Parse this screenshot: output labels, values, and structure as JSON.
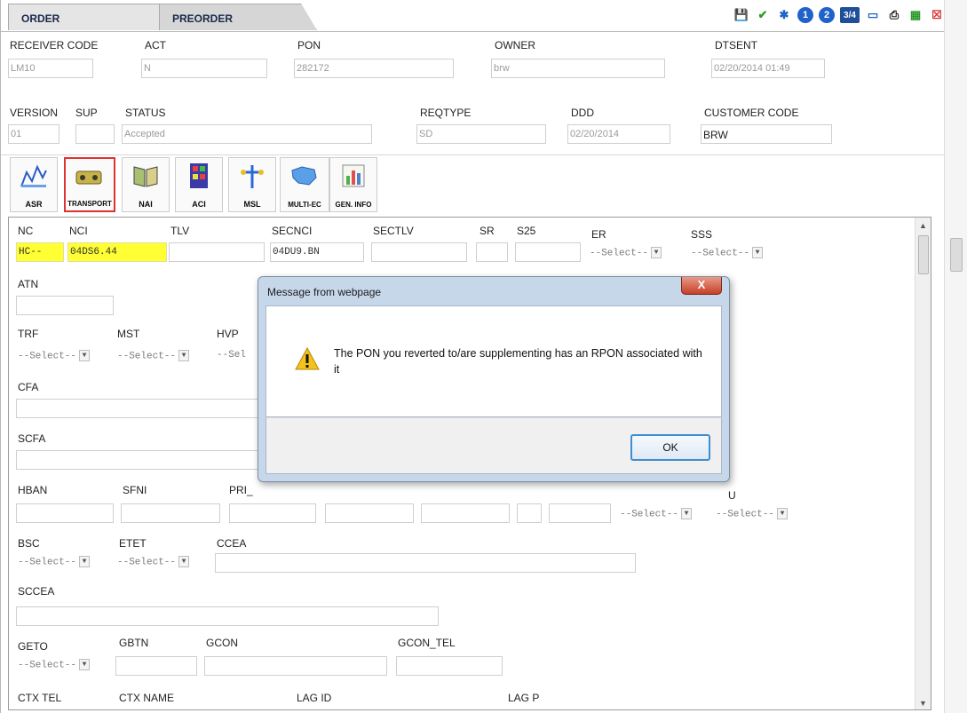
{
  "tabs": {
    "order": "ORDER",
    "preorder": "PREORDER"
  },
  "toolbar_icons": [
    "save-icon",
    "check-icon",
    "run-icon",
    "1",
    "2",
    "3/4",
    "book-icon",
    "print-icon",
    "export-icon",
    "close-icon"
  ],
  "header": {
    "receiver_code": {
      "label": "RECEIVER CODE",
      "value": "LM10"
    },
    "act": {
      "label": "ACT",
      "value": "N"
    },
    "pon": {
      "label": "PON",
      "value": "282172"
    },
    "owner": {
      "label": "OWNER",
      "value": "brw"
    },
    "dtsent": {
      "label": "DTSENT",
      "value": "02/20/2014 01:49"
    },
    "version": {
      "label": "VERSION",
      "value": "01"
    },
    "sup": {
      "label": "SUP",
      "value": ""
    },
    "status": {
      "label": "STATUS",
      "value": "Accepted"
    },
    "reqtype": {
      "label": "REQTYPE",
      "value": "SD"
    },
    "ddd": {
      "label": "DDD",
      "value": "02/20/2014"
    },
    "customer_code": {
      "label": "CUSTOMER CODE",
      "value": "BRW"
    }
  },
  "icon_buttons": {
    "asr": "ASR",
    "transport": "TRANSPORT",
    "nai": "NAI",
    "aci": "ACI",
    "msl": "MSL",
    "multi_ec": "MULTI-EC",
    "gen_info": "GEN. INFO"
  },
  "form": {
    "nc": {
      "label": "NC",
      "value": "HC--"
    },
    "nci": {
      "label": "NCI",
      "value": "04DS6.44"
    },
    "tlv": {
      "label": "TLV"
    },
    "secnci": {
      "label": "SECNCI",
      "value": "04DU9.BN"
    },
    "sectlv": {
      "label": "SECTLV"
    },
    "sr": {
      "label": "SR"
    },
    "s25": {
      "label": "S25"
    },
    "er": {
      "label": "ER"
    },
    "sss": {
      "label": "SSS"
    },
    "select_placeholder": "--Select--",
    "sel_partial": "--Sel",
    "atn": {
      "label": "ATN"
    },
    "trf": {
      "label": "TRF"
    },
    "mst": {
      "label": "MST"
    },
    "hvp": {
      "label": "HVP"
    },
    "cfa": {
      "label": "CFA"
    },
    "scfa": {
      "label": "SCFA"
    },
    "hban": {
      "label": "HBAN"
    },
    "sfni": {
      "label": "SFNI"
    },
    "pri": {
      "label": "PRI_"
    },
    "u": {
      "label": "U"
    },
    "bsc": {
      "label": "BSC"
    },
    "etet": {
      "label": "ETET"
    },
    "ccea": {
      "label": "CCEA"
    },
    "sccea": {
      "label": "SCCEA"
    },
    "geto": {
      "label": "GETO"
    },
    "gbtn": {
      "label": "GBTN"
    },
    "gcon": {
      "label": "GCON"
    },
    "gcon_tel": {
      "label": "GCON_TEL"
    },
    "ctx_tel": {
      "label": "CTX TEL"
    },
    "ctx_name": {
      "label": "CTX NAME"
    },
    "lag_id": {
      "label": "LAG ID"
    },
    "lag_p": {
      "label": "LAG P"
    }
  },
  "dialog": {
    "title": "Message from webpage",
    "message": "The PON you reverted to/are supplementing has an RPON associated with it",
    "ok": "OK",
    "close_glyph": "X"
  }
}
